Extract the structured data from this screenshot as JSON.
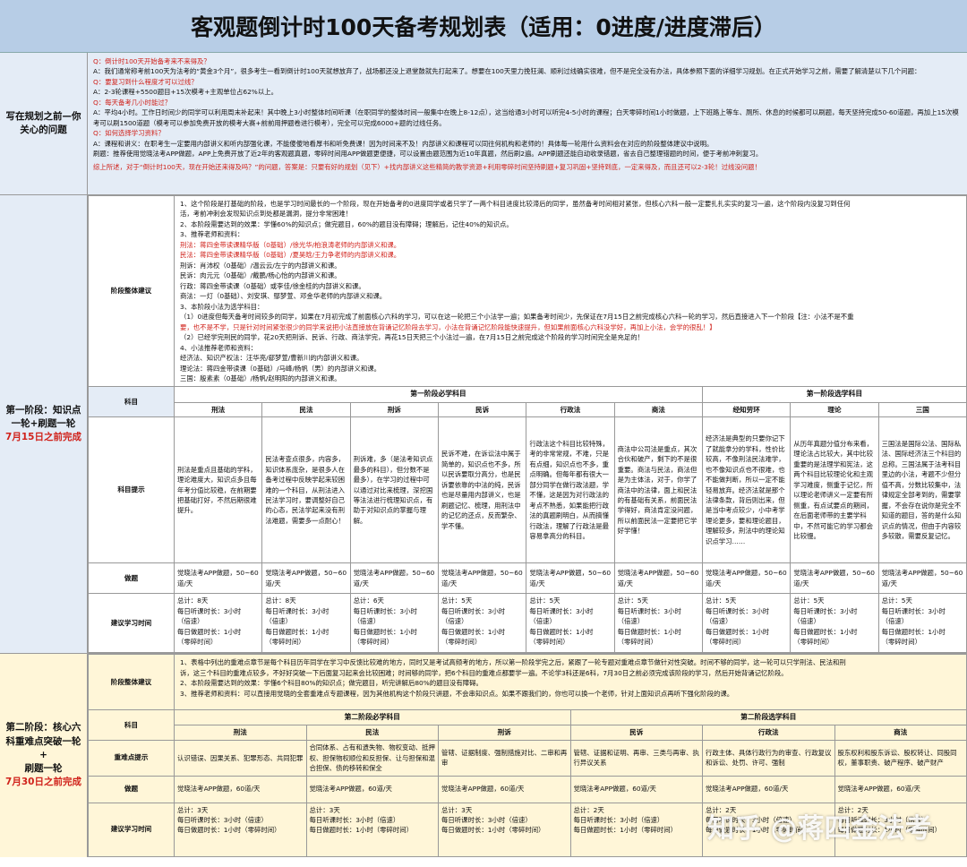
{
  "title": "客观题倒计时100天备考规划表（适用：0进度/进度滞后）",
  "section0": {
    "label": "写在规划之前—你关心的问题",
    "lines": [
      {
        "t": "Q：倒计时100天开始备考来不来得及？",
        "c": "q"
      },
      {
        "t": "A：我们通常称考前100天为法考的“黄金3个月”，很多考生一看到倒计时100天就想放弃了，战场都还没上退堂鼓就先打起来了。想要在100天里力挽狂澜、顺利过线确实很难，但不是完全没有办法，具体参照下面的详细学习规划。在正式开始学习之前，需要了解清楚以下几个问题：",
        "c": ""
      },
      {
        "t": "Q：要复习到什么程度才可以过线？",
        "c": "q"
      },
      {
        "t": "A：2-3轮课程+5500题目+15次模考+主观单位占62%以上。",
        "c": ""
      },
      {
        "t": "Q：每天备考几小时能过？",
        "c": "q"
      },
      {
        "t": "A：平均4小时。工作日时间少的同学可以利用周末补起来！其中晚上3小时整体时间听课（在职同学的整体时间一般集中在晚上8-12点），这当给通3小时可以听完4-5小时的课程；白天零碎时间1小时做题，上下班路上等车、厕所、休息的时候都可以刷题，每天坚持完成50-60道题，再加上15次模考可以刷1500道题（模考可以参加免费开放的模考大赛+前前用押题卷进行模考），完全可以完成6000+题的过线任务。",
        "c": ""
      },
      {
        "t": "Q：如何选择学习资料？",
        "c": "q"
      },
      {
        "t": "A：课程和讲义：在职考生一定要用内部讲义和听内部强化课，不能傻傻地看厚书和听免费课！因为时间来不及！内部讲义和课程可以同往何机构和老师的！具体每一轮用什么资料会在对应的阶段整体建议中说明。",
        "c": ""
      },
      {
        "t": "刷题：推荐使用觉晓法考APP做题，APP上免费开放了近2年的客观题真题，零碎时间用APP做题更便捷，可以设置由题范围为近10年真题，然后刷2遍。APP刷题还能自动收录错题，省去自己整理错题的时间，便于考前冲刺复习。",
        "c": ""
      },
      {
        "t": "综上所述，对于“倒计时100天，现在开始还来得及吗？”的问题，答案是：只要有好的规划（见下）+找内部讲义这些精简的教学资源+利用零碎时间坚持刷题+复习巩固+坚持到底，一定来得及，而且还可以2-3轮！过线没问题！",
        "c": "summary"
      }
    ]
  },
  "stage1": {
    "label_lines": [
      "第一阶段：知识点",
      "一轮+刷题一轮"
    ],
    "deadline": "7月15日之前完成",
    "plan_label": "阶段整体建议",
    "plan_lines": [
      {
        "t": "1、这个阶段是打基础的阶段，也是学习时间最长的一个阶段，现在开始备考的0进度同学或者只学了一两个科目进度比较滞后的同学，虽然备考时间相对紧张，但核心六科一般一定要扎扎实实的复习一遍，这个阶段内没复习到任何",
        "c": ""
      },
      {
        "t": "  活，考前冲刺会发现知识点到处都是漏洞，提分非常困难！",
        "c": ""
      },
      {
        "t": "2、本阶段需要达到的效果：学懂60%的知识点；做完题目，60%的题目没有障碍；理解后，记住40%的知识点。",
        "c": ""
      },
      {
        "t": "3、推荐老师和资料：",
        "c": ""
      },
      {
        "t": "刑法：蒋四金带读课精华版（0基础）/徐光华/柏浪涛老师的内部讲义和课。",
        "c": "r1"
      },
      {
        "t": "民法：蒋四金带读课精华版（0基础）/夏昊晗/王力争老师的内部讲义和课。",
        "c": "r2"
      },
      {
        "t": "刑诉：肖沛权（0基础）/温云云/左宁的内部讲义和课。",
        "c": ""
      },
      {
        "t": "民诉：肉元元（0基础）/戴鹏/杨心怡的内部讲义和课。",
        "c": ""
      },
      {
        "t": "行政：蒋四金带读课（0基础）或李佳/徐金桂的内部讲义和课。",
        "c": ""
      },
      {
        "t": "商法：一灯（0基础）、刘安琪、鄢梦萱、邓金华老师的内部讲义和课。",
        "c": ""
      },
      {
        "t": "3、本阶段小法为选学科目：",
        "c": ""
      },
      {
        "t": "（1）0进度但每天备考时间较多的同学，如果在7月初完成了前面核心六科的学习，可以在这一轮把三个小法学一遍；如果备考时间少，先保证在7月15日之前完成核心六科一轮的学习，然后直接进入下一个阶段【注：小法不是不重",
        "c": "m1"
      },
      {
        "t": "要，也不是不学，只是针对时间紧张很少的同学来说把小法直接放在背诵记忆阶段去学习，小法在背诵记忆阶段能快速提升，但如果前面核心六科没学好，再加上小法，会学的很乱！】",
        "c": "red"
      },
      {
        "t": "（2）已经学完刑民的同学，花20天把刑诉、民诉、行政、商法学完，再花15日天把三个小法过一遍，在7月15日之前完成这个阶段的学习时间完全是充足的！",
        "c": ""
      },
      {
        "t": "4、小法推荐老师和资料：",
        "c": ""
      },
      {
        "t": "经济法、知识产权法：汪华亮/郄梦萱/曹新川的内部讲义和课。",
        "c": ""
      },
      {
        "t": "理论法：蒋四金带读课（0基础）/马峰/杨帆（男）的内部讲义和课。",
        "c": ""
      },
      {
        "t": "三国：殷素素（0基础）/杨帆/赵明阳的内部讲义和课。",
        "c": ""
      }
    ],
    "must_head": "第一阶段必学科目",
    "opt_head": "第一阶段选学科目",
    "subj_label": "科目",
    "tips_label": "科目提示",
    "practice_label": "做题",
    "time_label": "建议学习时间",
    "subjects": [
      "刑法",
      "民法",
      "刑诉",
      "民诉",
      "行政法",
      "商法",
      "经知劳环",
      "理论",
      "三国"
    ],
    "tips": [
      "刑法是重点且基础的学科，理论难度大，知识点多且每年考分值比较稳，在前期要把基础打好，不然后期很难提升。",
      "民法考查点很多，内容多，知识体系庞杂，是很多人在备考过程中反映学起来较困难的一个科目，从刑法进入民法学习时，要调整好自己的心态，民法学起来没有刑法难题，需要多一点耐心！",
      "刑诉难，多（是法考知识点最多的科目），但分数不是最多），在学习的过程中可以通过对比来梳理，深挖国等法法进行梳理知识点，有助于对知识点的掌握与理解。",
      "民诉不难，在诉讼法中属于简单的，知识点也不多，所以民诉要取分高分，也是民诉要依靠的中法的纯，民诉也是尽量用内部讲义，也是刷题记忆、梳理，用刑法中的记忆的还点，反而繁杂、学不懂。",
      "行政法这个科目比较特殊，考的非常常规，不难，只是有点细，知识点也不多，重点明确。但每年都有很大一部分同学在做行政法题，学不懂，这是因为对行政法的考点不熟悉，如果能把行政法的真题刷明白，从而搞懂行政法，理解了行政法是最容易拿高分的科目。",
      "商法中公司法是重点，其次合伙和破产，剩下的不是很重要。商法与民法，商法但是为主体法，对于，你学了商法中的法律，面上和民法的有基础有关系，前面民法学得好，商法肯定没问题，所以前面民法一定要把它学好学懂！",
      "经济法是典型的只要你记下了就能拿分的学科，性价比较高，不像刑法民法难学，也不像知识点也不很难，也不能做判断，所以一定不能轻易放弃。经济法就是那个法律条款，背后则出来，但是当中考点较少，小中考学理论更多，要和理论题目，理解较多，刑法中的理论知识点学习……",
      "从历年真题分值分布来看，理论法占比较大，其中比较重要的是法理学和宪法，这两个科目比较理论化和主观学习难度，侧重于记忆，所以理论老师讲义一定要有所侧重，有点试要点的期间，在后面老师带的主要学科中，不然可能它的学习都会比较慢。",
      "三国法是国际公法、国际私法、国际经济法三个科目的总称。三国法属于法考科目里边的小法，考题不少但分值不高，分数比较集中，法律规定全部考到的，需要掌握，不会存在说你是完全不知道的题目，答的是什么知识点的情况，但由于内容较多较散，需要反复记忆。"
    ],
    "practice": "觉晓法考APP做题，50~60道/天",
    "times": [
      {
        "total": "总计：8天",
        "h1": "每日听课时长：3小时",
        "h2": "（倍速）",
        "h3": "每日做题时长：1小时",
        "h4": "（零碎时间）"
      },
      {
        "total": "总计：8天",
        "h1": "每日听课时长：3小时",
        "h2": "（倍速）",
        "h3": "每日做题时长：1小时",
        "h4": "（零碎时间）"
      },
      {
        "total": "总计：6天",
        "h1": "每日听课时长：3小时",
        "h2": "（倍速）",
        "h3": "每日做题时长：1小时",
        "h4": "（零碎时间）"
      },
      {
        "total": "总计：5天",
        "h1": "每日听课时长：3小时",
        "h2": "（倍速）",
        "h3": "每日做题时长：1小时",
        "h4": "（零碎时间）"
      },
      {
        "total": "总计：5天",
        "h1": "每日听课时长：3小时",
        "h2": "（倍速）",
        "h3": "每日做题时长：1小时",
        "h4": "（零碎时间）"
      },
      {
        "total": "总计：5天",
        "h1": "每日听课时长：3小时",
        "h2": "（倍速）",
        "h3": "每日做题时长：1小时",
        "h4": "（零碎时间）"
      },
      {
        "total": "总计：5天",
        "h1": "每日听课时长：3小时",
        "h2": "（倍速）",
        "h3": "每日做题时长：1小时",
        "h4": "（零碎时间）"
      },
      {
        "total": "总计：5天",
        "h1": "每日听课时长：3小时",
        "h2": "（倍速）",
        "h3": "每日做题时长：1小时",
        "h4": "（零碎时间）"
      },
      {
        "total": "总计：5天",
        "h1": "每日听课时长：3小时",
        "h2": "（倍速）",
        "h3": "每日做题时长：1小时",
        "h4": "（零碎时间）"
      }
    ]
  },
  "stage2": {
    "label_lines": [
      "第二阶段：核心六",
      "科重难点突破一轮+",
      "刷题一轮"
    ],
    "deadline": "7月30日之前完成",
    "plan_label": "阶段整体建议",
    "plan_lines": [
      {
        "t": "1、表格中列出的重难点章节是每个科目历年同学在学习中反馈比较难的地方，同时又是考试高频考的地方，所以第一阶段学完之后，紧跟了一轮专题对重难点章节做针对性突破。时间不够的同学，这一轮可以只学刑法、民法和刑",
        "c": ""
      },
      {
        "t": "  诉，这三个科目的重难点较多，不好好突破一下后面复习起来会比较困难；时间够的同学，把6个科目的重难点都要学一遍。不论学3科还是6科，7月30日之前必须完成该阶段的学习，然后开始背诵记忆阶段。",
        "c": ""
      },
      {
        "t": "2、本阶段需要达到的效果：学懂6个科目80%的知识点；做完题目，听完讲解后80%的题目没有障碍。",
        "c": ""
      },
      {
        "t": "3、推荐老师和资料：可以直接用觉晓的全套重难点专题课程，因为其他机构这个阶段只讲题，不会串知识点。如果不跟我们的，你也可以换一个老师，针对上面知识点再听下强化阶段的课。",
        "c": ""
      }
    ],
    "must_head": "第二阶段必学科目",
    "opt_head": "第二阶段选学科目",
    "subj_label": "科目",
    "key_label": "重难点提示",
    "practice_label": "做题",
    "time_label": "建议学习时间",
    "subjects": [
      "刑法",
      "民法",
      "刑诉",
      "民诉",
      "行政法",
      "商法"
    ],
    "keys": [
      "认识错误、因果关系、犯罪形态、共同犯罪",
      "合同体系、占有和遗失物、物权变动、抵押权、担保物权顺位和反担保、让与担保和混合担保、债的移转和保全",
      "管辖、证据制度、强制措施对比、二审和再审",
      "管辖、证据和证明、再审、三类与再审、执行异议关系",
      "行政主体、具体行政行为的审查、行政复议和诉讼、处罚、许可、强制",
      "股东权利和股东诉讼、股权转让、同股同权，董事职责、破产程序、破产财产"
    ],
    "practice": "觉晓法考APP做题，60道/天",
    "times": [
      {
        "total": "总计：3天",
        "h1": "每日听课时长：3小时（倍速）",
        "h3": "每日做题时长：1小时（零碎时间）"
      },
      {
        "total": "总计：3天",
        "h1": "每日听课时长：3小时（倍速）",
        "h3": "每日做题时长：1小时（零碎时间）"
      },
      {
        "total": "总计：3天",
        "h1": "每日听课时长：3小时（倍速）",
        "h3": "每日做题时长：1小时（零碎时间）"
      },
      {
        "total": "总计：2天",
        "h1": "每日听课时长：3小时（倍速）",
        "h3": "每日做题时长：1小时（零碎时间）"
      },
      {
        "total": "总计：2天",
        "h1": "每日听课时长：3小时（倍速）",
        "h3": "每日做题时长：1小时（零碎时间）"
      },
      {
        "total": "总计：2天",
        "h1": "每日听课时长：3小时（倍速）",
        "h3": "每日做题时长：1小时（零碎时间）"
      }
    ]
  },
  "watermark": "知乎 @蒋四金法考"
}
